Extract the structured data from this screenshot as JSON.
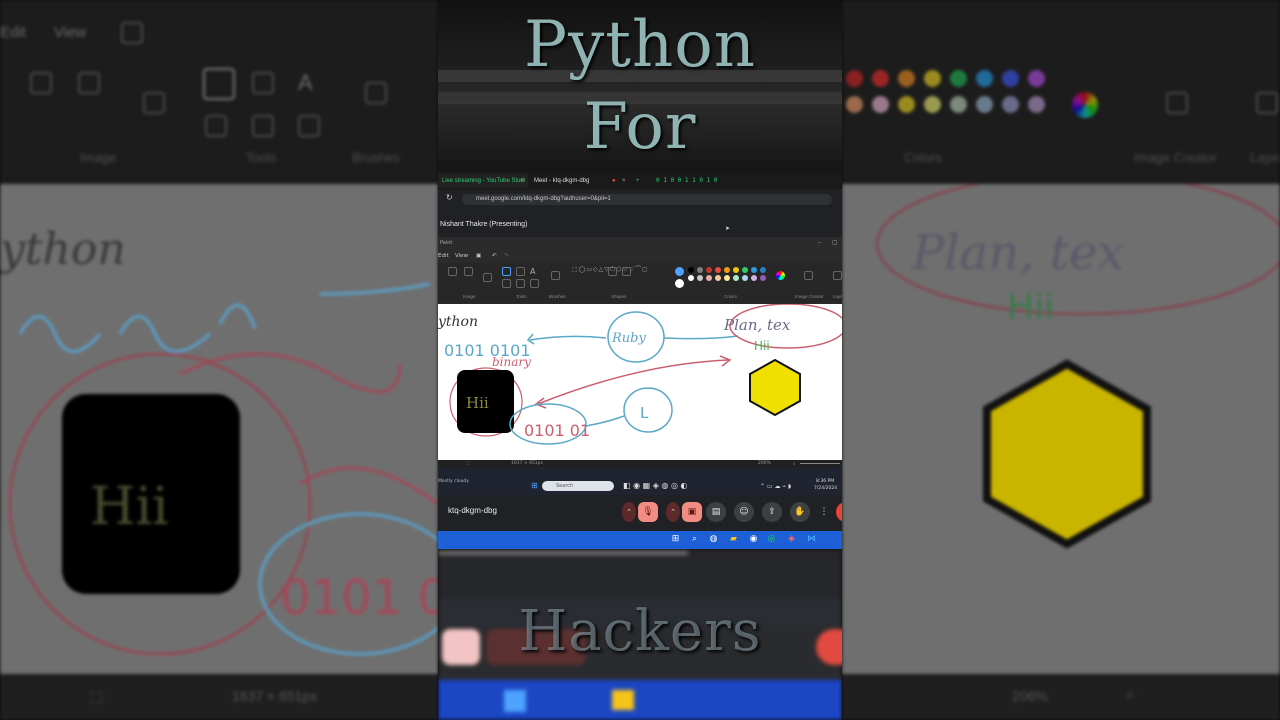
{
  "overlay": {
    "title_top": "Python",
    "title_mid": "For",
    "title_bottom": "Hackers"
  },
  "browser": {
    "tabs": [
      {
        "label": "Live streaming - YouTube Studi",
        "active": true
      },
      {
        "label": "Meet - ktq-dkgm-dbg",
        "active": false
      }
    ],
    "url": "meet.google.com/ktq-dkgm-dbg?authuser=0&pli=1"
  },
  "meet": {
    "presenter": "Nishant Thakre (Presenting)",
    "meeting_code": "ktq-dkgm-dbg"
  },
  "paint": {
    "app_title": "Paint",
    "menu": {
      "edit": "Edit",
      "view": "View"
    },
    "groups": {
      "image": "Image",
      "tools": "Tools",
      "brushes": "Brushes",
      "shapes": "Shapes",
      "colors": "Colors",
      "image_creator": "Image Creator",
      "layers": "Layers"
    },
    "canvas": {
      "python": "ython",
      "binary1": "0101 0101",
      "binary_label": "binary",
      "ruby": "Ruby",
      "hii_box": "Hii",
      "binary2": "0101 01",
      "letter_l": "L",
      "plan": "Plan, tex",
      "hii_note": "Hii"
    },
    "status": {
      "dimensions": "1637 × 651px",
      "zoom": "206%"
    },
    "palette": [
      "#000000",
      "#7f7f7f",
      "#c0392b",
      "#e74c3c",
      "#f39c12",
      "#f1c40f",
      "#2ecc71",
      "#3498db",
      "#2980b9",
      "#9b59b6",
      "#ffffff",
      "#c8c8c8",
      "#e6b0aa",
      "#f5cba7",
      "#f9e79f",
      "#abebc6",
      "#aed6f1",
      "#d2b4de"
    ]
  },
  "taskbar": {
    "search_placeholder": "Search",
    "weather": "Mostly cloudy",
    "clock_time": "8:36 PM",
    "clock_date": "7/24/2024"
  }
}
